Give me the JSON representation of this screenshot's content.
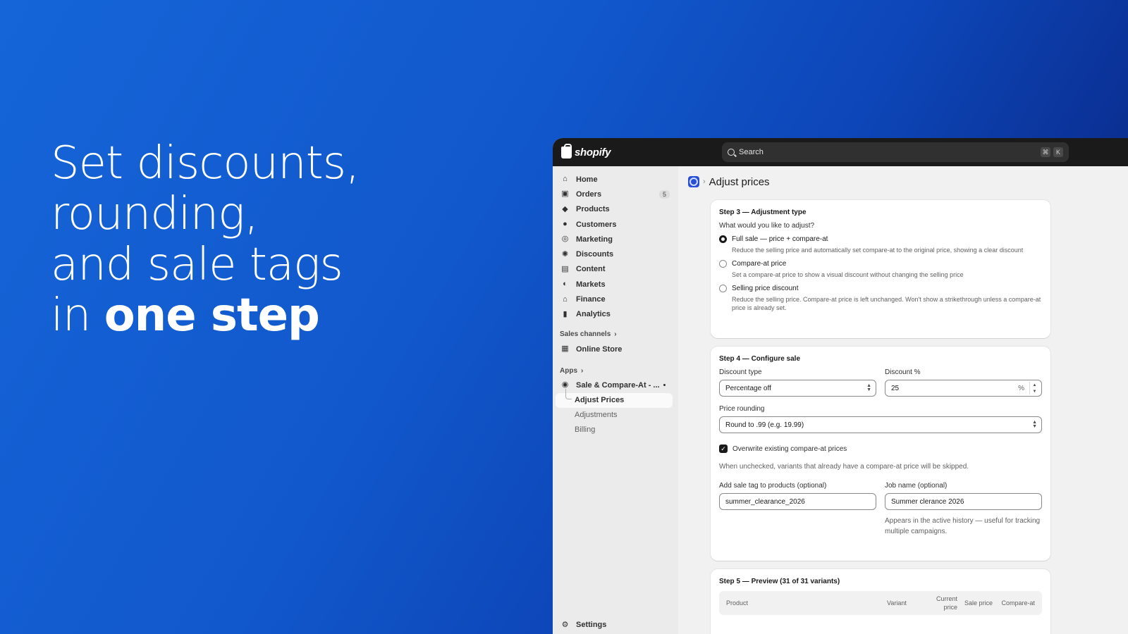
{
  "hero": {
    "line1": "Set discounts,",
    "line2": "rounding,",
    "line3": "and sale tags",
    "line4_prefix": "in ",
    "line4_bold": "one step"
  },
  "topbar": {
    "logo_text": "shopify",
    "search_placeholder": "Search",
    "shortcut_keys": [
      "⌘",
      "K"
    ]
  },
  "sidebar": {
    "items": [
      {
        "label": "Home",
        "icon": "home-icon"
      },
      {
        "label": "Orders",
        "icon": "orders-icon",
        "badge": "5"
      },
      {
        "label": "Products",
        "icon": "tag-icon"
      },
      {
        "label": "Customers",
        "icon": "person-icon"
      },
      {
        "label": "Marketing",
        "icon": "target-icon"
      },
      {
        "label": "Discounts",
        "icon": "discount-icon"
      },
      {
        "label": "Content",
        "icon": "content-icon"
      },
      {
        "label": "Markets",
        "icon": "globe-icon"
      },
      {
        "label": "Finance",
        "icon": "bank-icon"
      },
      {
        "label": "Analytics",
        "icon": "bar-chart-icon"
      }
    ],
    "sales_channels_label": "Sales channels",
    "online_store": "Online Store",
    "apps_label": "Apps",
    "app_name": "Sale & Compare-At - ...",
    "app_sub": [
      "Adjust Prices",
      "Adjustments",
      "Billing"
    ],
    "settings": "Settings"
  },
  "page": {
    "title": "Adjust prices"
  },
  "step3": {
    "heading": "Step 3 — Adjustment type",
    "question": "What would you like to adjust?",
    "options": [
      {
        "label": "Full sale — price + compare-at",
        "desc": "Reduce the selling price and automatically set compare-at to the original price, showing a clear discount",
        "selected": true
      },
      {
        "label": "Compare-at price",
        "desc": "Set a compare-at price to show a visual discount without changing the selling price",
        "selected": false
      },
      {
        "label": "Selling price discount",
        "desc": "Reduce the selling price. Compare-at price is left unchanged. Won't show a strikethrough unless a compare-at price is already set.",
        "selected": false
      }
    ]
  },
  "step4": {
    "heading": "Step 4 — Configure sale",
    "discount_type_label": "Discount type",
    "discount_type_value": "Percentage off",
    "discount_pct_label": "Discount %",
    "discount_pct_value": "25",
    "pct_suffix": "%",
    "rounding_label": "Price rounding",
    "rounding_value": "Round to .99 (e.g. 19.99)",
    "overwrite_label": "Overwrite existing compare-at prices",
    "overwrite_checked": true,
    "overwrite_help": "When unchecked, variants that already have a compare-at price will be skipped.",
    "sale_tag_label": "Add sale tag to products (optional)",
    "sale_tag_value": "summer_clearance_2026",
    "job_name_label": "Job name (optional)",
    "job_name_value": "Summer clerance 2026",
    "job_name_help": "Appears in the active history — useful for tracking multiple campaigns."
  },
  "step5": {
    "heading": "Step 5 — Preview (31 of 31 variants)",
    "columns": [
      "Product",
      "Variant",
      "Current price",
      "Sale price",
      "Compare-at"
    ]
  },
  "colors": {
    "accent": "#1565d8",
    "topbar": "#1a1a1a"
  }
}
